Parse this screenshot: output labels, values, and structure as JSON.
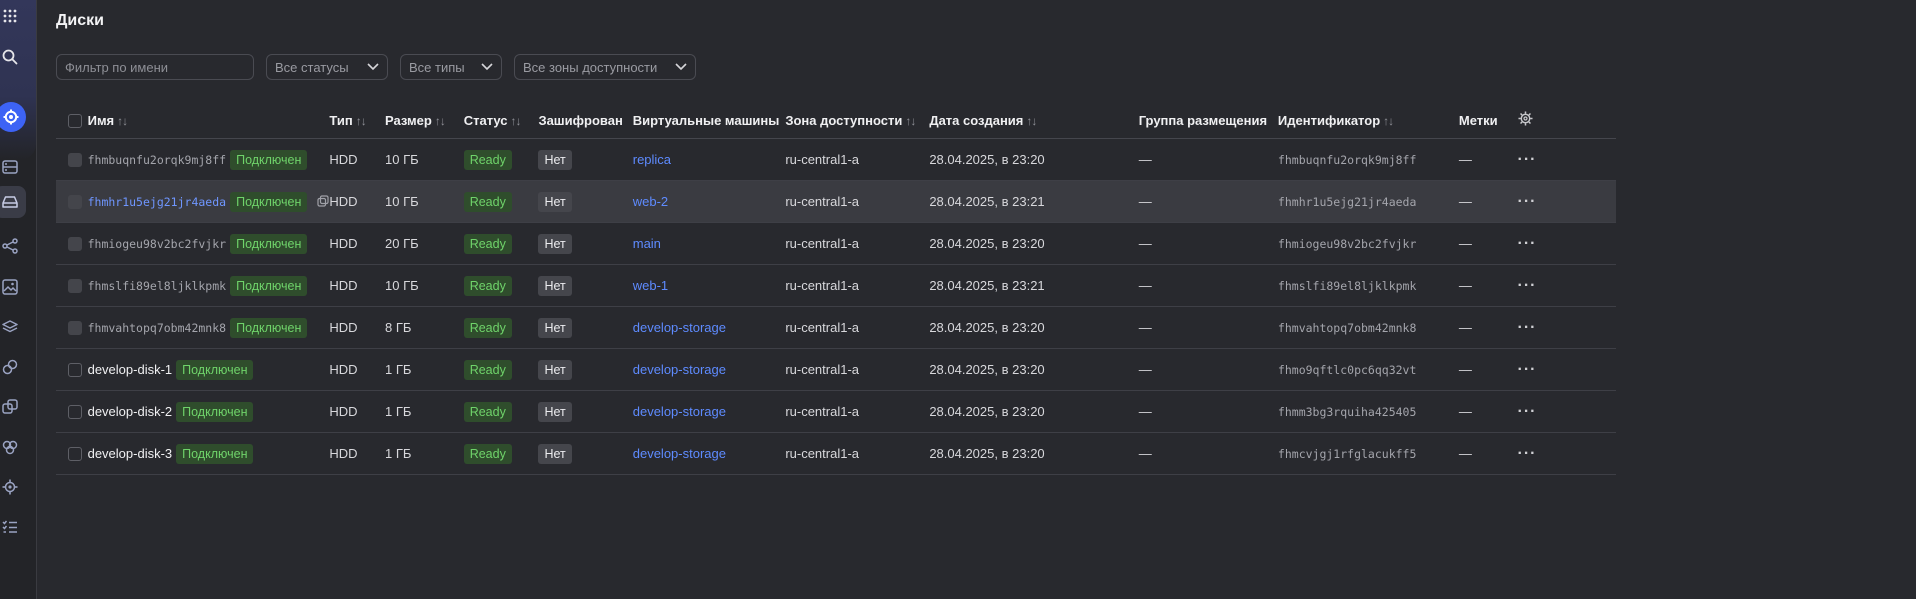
{
  "page": {
    "title": "Диски"
  },
  "filters": {
    "name_placeholder": "Фильтр по имени",
    "status": "Все статусы",
    "type": "Все типы",
    "zone": "Все зоны доступности"
  },
  "columns": {
    "name": "Имя",
    "type": "Тип",
    "size": "Размер",
    "status": "Статус",
    "encrypted": "Зашифрован",
    "vms": "Виртуальные машины",
    "zone": "Зона доступности",
    "created": "Дата создания",
    "placement": "Группа размещения",
    "id": "Идентификатор",
    "labels": "Метки"
  },
  "rows": [
    {
      "name": "fhmbuqnfu2orqk9mj8ff",
      "attached": "Подключен",
      "type": "HDD",
      "size": "10 ГБ",
      "status": "Ready",
      "encrypted": "Нет",
      "vm": "replica",
      "zone": "ru-central1-a",
      "created": "28.04.2025, в 23:20",
      "placement": "—",
      "id": "fhmbuqnfu2orqk9mj8ff",
      "labels": "—"
    },
    {
      "name": "fhmhr1u5ejg21jr4aeda",
      "attached": "Подключен",
      "type": "HDD",
      "size": "10 ГБ",
      "status": "Ready",
      "encrypted": "Нет",
      "vm": "web-2",
      "zone": "ru-central1-a",
      "created": "28.04.2025, в 23:21",
      "placement": "—",
      "id": "fhmhr1u5ejg21jr4aeda",
      "labels": "—"
    },
    {
      "name": "fhmiogeu98v2bc2fvjkr",
      "attached": "Подключен",
      "type": "HDD",
      "size": "20 ГБ",
      "status": "Ready",
      "encrypted": "Нет",
      "vm": "main",
      "zone": "ru-central1-a",
      "created": "28.04.2025, в 23:20",
      "placement": "—",
      "id": "fhmiogeu98v2bc2fvjkr",
      "labels": "—"
    },
    {
      "name": "fhmslfi89el8ljklkpmk",
      "attached": "Подключен",
      "type": "HDD",
      "size": "10 ГБ",
      "status": "Ready",
      "encrypted": "Нет",
      "vm": "web-1",
      "zone": "ru-central1-a",
      "created": "28.04.2025, в 23:21",
      "placement": "—",
      "id": "fhmslfi89el8ljklkpmk",
      "labels": "—"
    },
    {
      "name": "fhmvahtopq7obm42mnk8",
      "attached": "Подключен",
      "type": "HDD",
      "size": "8 ГБ",
      "status": "Ready",
      "encrypted": "Нет",
      "vm": "develop-storage",
      "zone": "ru-central1-a",
      "created": "28.04.2025, в 23:20",
      "placement": "—",
      "id": "fhmvahtopq7obm42mnk8",
      "labels": "—"
    },
    {
      "name": "develop-disk-1",
      "attached": "Подключен",
      "type": "HDD",
      "size": "1 ГБ",
      "status": "Ready",
      "encrypted": "Нет",
      "vm": "develop-storage",
      "zone": "ru-central1-a",
      "created": "28.04.2025, в 23:20",
      "placement": "—",
      "id": "fhmo9qftlc0pc6qq32vt",
      "labels": "—"
    },
    {
      "name": "develop-disk-2",
      "attached": "Подключен",
      "type": "HDD",
      "size": "1 ГБ",
      "status": "Ready",
      "encrypted": "Нет",
      "vm": "develop-storage",
      "zone": "ru-central1-a",
      "created": "28.04.2025, в 23:20",
      "placement": "—",
      "id": "fhmm3bg3rquiha425405",
      "labels": "—"
    },
    {
      "name": "develop-disk-3",
      "attached": "Подключен",
      "type": "HDD",
      "size": "1 ГБ",
      "status": "Ready",
      "encrypted": "Нет",
      "vm": "develop-storage",
      "zone": "ru-central1-a",
      "created": "28.04.2025, в 23:20",
      "placement": "—",
      "id": "fhmcvjgj1rfglacukff5",
      "labels": "—"
    }
  ]
}
